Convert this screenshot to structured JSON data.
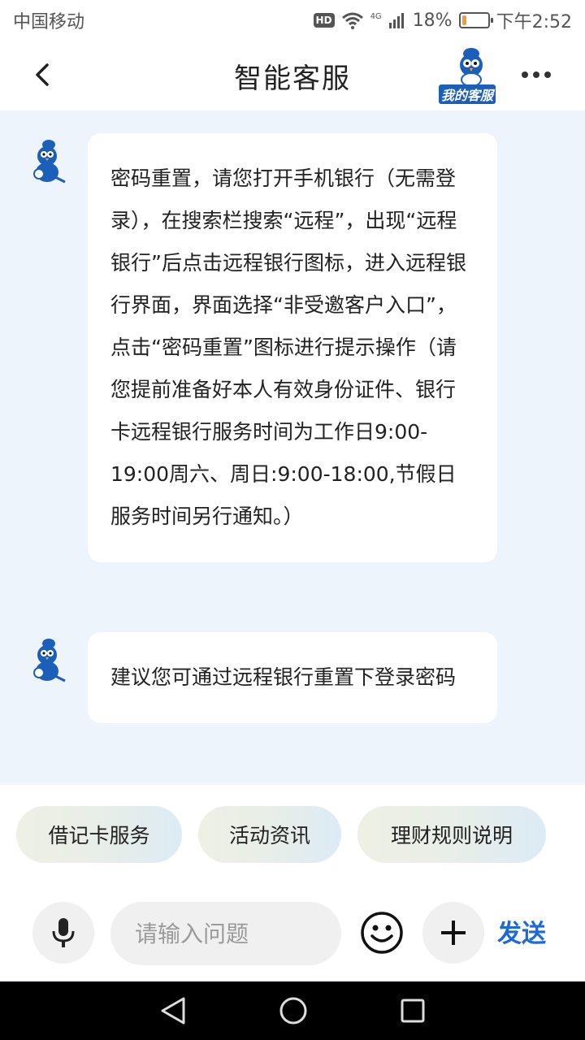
{
  "status_bar": {
    "carrier": "中国移动",
    "hd": "HD",
    "network": "4G",
    "battery": "18%",
    "battery_level": 0.18,
    "time": "下午2:52"
  },
  "header": {
    "title": "智能客服",
    "brand_label": "我的客服"
  },
  "messages": [
    {
      "sender": "bot",
      "text": "密码重置，请您打开手机银行（无需登录），在搜索栏搜索“远程”，出现“远程银行”后点击远程银行图标，进入远程银行界面，界面选择“非受邀客户入口”，点击“密码重置”图标进行提示操作（请您提前准备好本人有效身份证件、银行卡远程银行服务时间为工作日9:00-19:00周六、周日:9:00-18:00,节假日服务时间另行通知。）"
    },
    {
      "sender": "bot",
      "text": "建议您可通过远程银行重置下登录密码"
    }
  ],
  "quick_replies": [
    "借记卡服务",
    "活动资讯",
    "理财规则说明"
  ],
  "input": {
    "placeholder": "请输入问题",
    "value": "",
    "send_label": "发送"
  },
  "colors": {
    "accent": "#1b6ad6",
    "chat_bg": "#eef4fc",
    "battery": "#e6a23c"
  },
  "icons": [
    "back-arrow-icon",
    "more-icon",
    "mic-icon",
    "emoji-icon",
    "plus-icon",
    "nav-back-icon",
    "nav-home-icon",
    "nav-recents-icon",
    "wifi-icon",
    "signal-icon",
    "battery-icon"
  ]
}
